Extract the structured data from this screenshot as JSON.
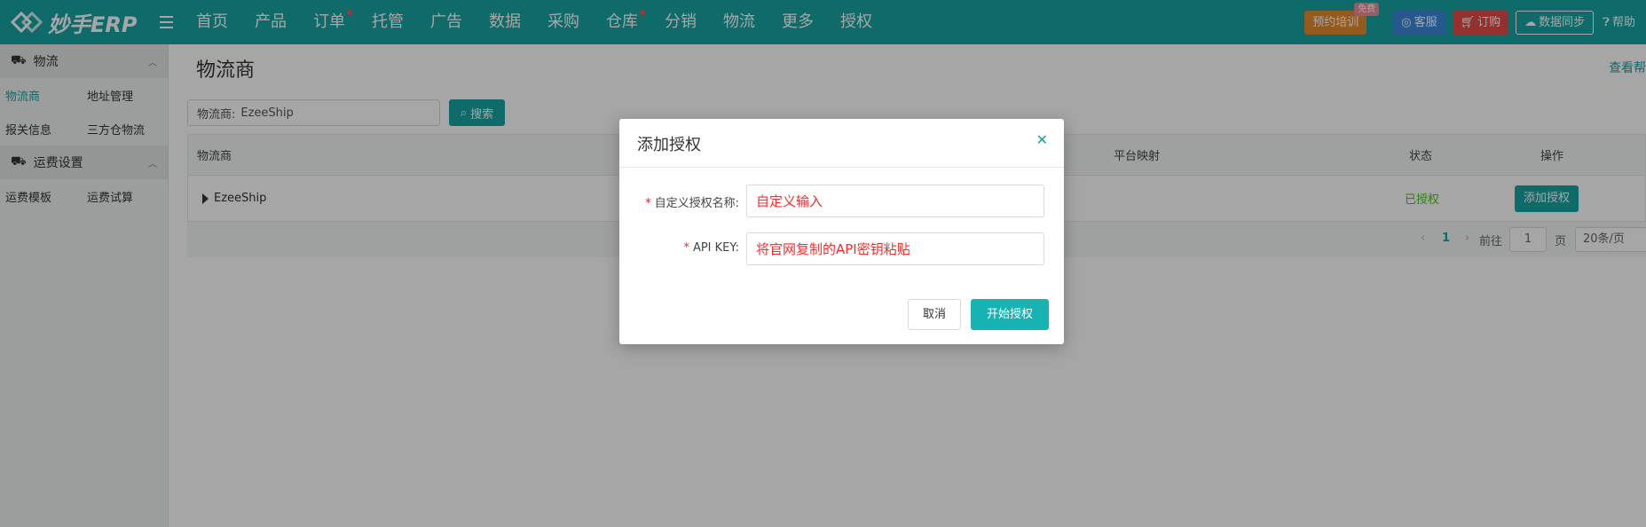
{
  "brand": {
    "name": "妙手ERP"
  },
  "nav": {
    "items": [
      {
        "label": "首页",
        "dot": false
      },
      {
        "label": "产品",
        "dot": false
      },
      {
        "label": "订单",
        "dot": true
      },
      {
        "label": "托管",
        "dot": false
      },
      {
        "label": "广告",
        "dot": false
      },
      {
        "label": "数据",
        "dot": false
      },
      {
        "label": "采购",
        "dot": false
      },
      {
        "label": "仓库",
        "dot": true
      },
      {
        "label": "分销",
        "dot": false
      },
      {
        "label": "物流",
        "dot": false
      },
      {
        "label": "更多",
        "dot": false
      },
      {
        "label": "授权",
        "dot": false
      }
    ]
  },
  "top_right": {
    "training": "预约培训",
    "training_badge": "免费",
    "service": "客服",
    "subscribe": "订购",
    "sync": "数据同步",
    "help": "帮助"
  },
  "sidebar": {
    "groups": [
      {
        "label": "物流",
        "links": [
          [
            "物流商",
            "地址管理"
          ],
          [
            "报关信息",
            "三方仓物流"
          ]
        ]
      },
      {
        "label": "运费设置",
        "links": [
          [
            "运费模板",
            "运费试算"
          ]
        ]
      }
    ],
    "active": "物流商"
  },
  "main": {
    "title": "物流商",
    "top_link": "查看帮",
    "filter_label": "物流商:",
    "filter_value": "EzeeShip",
    "search_label": "搜索",
    "columns": {
      "carrier": "物流商",
      "mapping": "平台映射",
      "status": "状态",
      "action": "操作"
    },
    "rows": [
      {
        "carrier": "EzeeShip",
        "status": "已授权",
        "action": "添加授权"
      }
    ],
    "pager": {
      "prev": "‹",
      "page": "1",
      "next": "›",
      "goto": "前往",
      "goto_value": "1",
      "page_unit": "页",
      "page_size": "20条/页"
    }
  },
  "dialog": {
    "title": "添加授权",
    "name_label": "自定义授权名称:",
    "name_placeholder": "自定义输入",
    "key_label": "API KEY:",
    "key_placeholder": "将官网复制的API密钥粘贴",
    "cancel": "取消",
    "confirm": "开始授权"
  },
  "colors": {
    "primary": "#17a4a4",
    "required": "#f5222d",
    "hint": "#ff2a2a"
  }
}
